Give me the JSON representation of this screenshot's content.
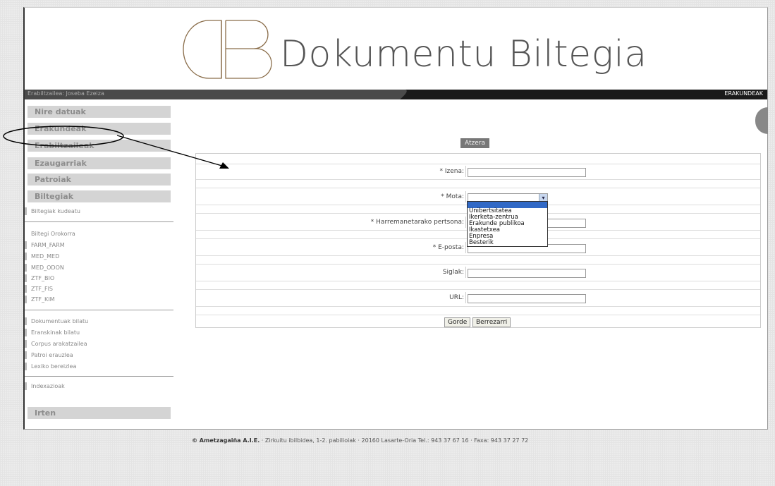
{
  "logo": {
    "mark": "DB",
    "title": "Dokumentu Biltegia"
  },
  "topbar": {
    "user_label": "Erabiltzailea: Joseba Ezeiza",
    "section": "ERAKUNDEAK"
  },
  "sidebar": {
    "main_items": [
      "Nire datuak",
      "Erakundeak",
      "Erabiltzaileak",
      "Ezaugarriak",
      "Patroiak",
      "Biltegiak"
    ],
    "manage_link": "Biltegiak kudeatu",
    "repositories": [
      "Biltegi Orokorra",
      "FARM_FARM",
      "MED_MED",
      "MED_ODON",
      "ZTF_BIO",
      "ZTF_FIS",
      "ZTF_KIM"
    ],
    "tools": [
      "Dokumentuak bilatu",
      "Eranskinak bilatu",
      "Corpus arakatzailea",
      "Patroi erauzlea",
      "Lexiko bereizlea"
    ],
    "indexing": "Indexazioak",
    "logout": "Irten"
  },
  "form": {
    "back_label": "Atzera",
    "fields": {
      "izena": {
        "label": "* Izena:",
        "value": ""
      },
      "mota": {
        "label": "* Mota:",
        "value": ""
      },
      "harremanetarako": {
        "label": "* Harremanetarako pertsona:",
        "value": ""
      },
      "eposta": {
        "label": "* E-posta:",
        "value": ""
      },
      "siglak": {
        "label": "Siglak:",
        "value": ""
      },
      "url": {
        "label": "URL:",
        "value": ""
      }
    },
    "mota_options": [
      "",
      "Unibertsitatea",
      "Ikerketa-zentrua",
      "Erakunde publikoa",
      "Ikastetxea",
      "Enpresa",
      "Besterik"
    ],
    "save_label": "Gorde",
    "reset_label": "Berrezarri"
  },
  "footer": {
    "company": "© Ametzagaiña A.I.E.",
    "text": " · Zirkuitu ibilbidea, 1-2. pabilioiak · 20160 Lasarte-Oria Tel.: 943 37 67 16 · Faxa: 943 37 27 72"
  },
  "colors": {
    "nav_bg": "#d4d4d4",
    "nav_text": "#8c8c8c",
    "topbar": "#1a1a1a",
    "dropdown_selected": "#3169c6"
  }
}
